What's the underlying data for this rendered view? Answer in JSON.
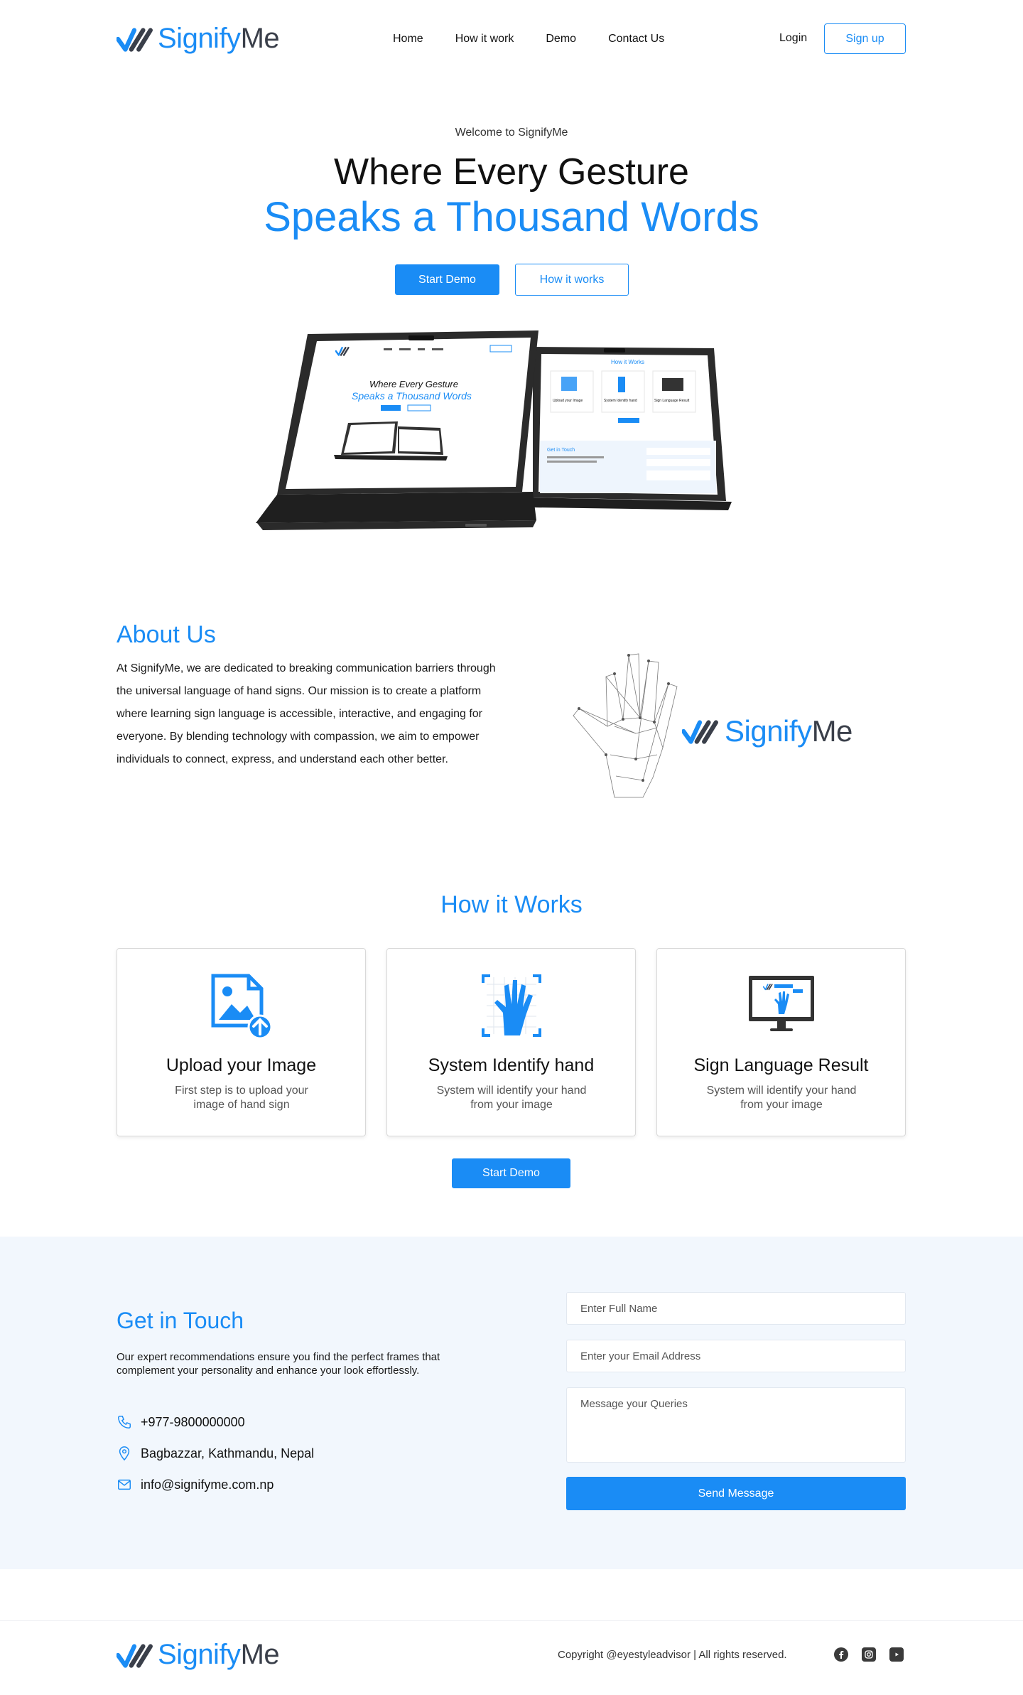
{
  "brand": {
    "name_part1": "Signify",
    "name_part2": "Me"
  },
  "nav": {
    "items": [
      {
        "label": "Home"
      },
      {
        "label": "How it work"
      },
      {
        "label": "Demo"
      },
      {
        "label": "Contact Us"
      }
    ],
    "login_label": "Login",
    "signup_label": "Sign up"
  },
  "hero": {
    "eyebrow": "Welcome to SignifyMe",
    "title_line1": "Where Every Gesture",
    "title_line2": "Speaks a Thousand Words",
    "start_demo_label": "Start Demo",
    "how_it_works_label": "How it works"
  },
  "laptop_preview": {
    "left_screen": {
      "title_line1": "Where Every Gesture",
      "title_line2": "Speaks a Thousand Words"
    },
    "right_screen": {
      "section_title": "How it Works",
      "step1": "Upload your Image",
      "step2": "System Identify hand",
      "step3": "Sign Language Result",
      "contact_title": "Get in Touch"
    }
  },
  "about": {
    "title": "About Us",
    "body": "At SignifyMe, we are dedicated to breaking communication barriers through the universal language of hand signs. Our mission is to create a platform where learning sign language is accessible, interactive, and engaging for everyone. By blending technology with compassion, we aim to empower individuals to connect, express, and understand each other better."
  },
  "how": {
    "title": "How it Works",
    "cards": [
      {
        "title": "Upload your Image",
        "desc": "First step is to upload your image of hand sign",
        "icon": "upload-image-icon"
      },
      {
        "title": "System Identify hand",
        "desc": "System will identify your hand from your image",
        "icon": "hand-scan-icon"
      },
      {
        "title": "Sign Language Result",
        "desc": "System will identify your hand from your image",
        "icon": "monitor-result-icon"
      }
    ],
    "start_demo_label": "Start Demo"
  },
  "contact": {
    "title": "Get in Touch",
    "desc": "Our expert recommendations ensure you find the perfect frames that complement your personality and enhance your look effortlessly.",
    "phone": "+977-9800000000",
    "address": "Bagbazzar, Kathmandu, Nepal",
    "email": "info@signifyme.com.np",
    "name_placeholder": "Enter Full Name",
    "email_placeholder": "Enter your Email Address",
    "message_placeholder": "Message your Queries",
    "send_label": "Send Message"
  },
  "footer": {
    "copyright": "Copyright @eyestyleadvisor | All rights reserved.",
    "social": [
      "facebook-icon",
      "instagram-icon",
      "youtube-icon"
    ]
  },
  "colors": {
    "accent": "#1a8cf5",
    "dark": "#3a3f4a",
    "contact_bg": "#f2f7fd"
  }
}
